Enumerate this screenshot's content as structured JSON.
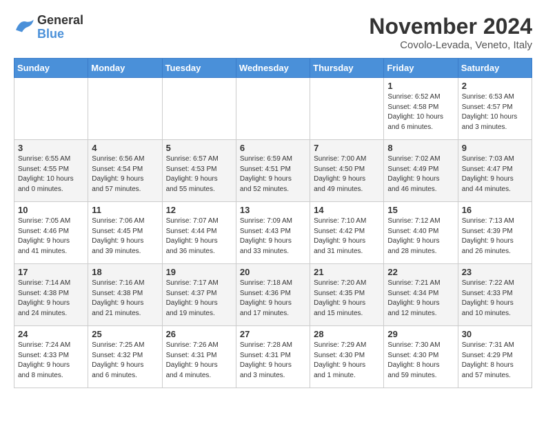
{
  "header": {
    "logo_line1": "General",
    "logo_line2": "Blue",
    "month": "November 2024",
    "location": "Covolo-Levada, Veneto, Italy"
  },
  "weekdays": [
    "Sunday",
    "Monday",
    "Tuesday",
    "Wednesday",
    "Thursday",
    "Friday",
    "Saturday"
  ],
  "weeks": [
    [
      {
        "day": "",
        "info": ""
      },
      {
        "day": "",
        "info": ""
      },
      {
        "day": "",
        "info": ""
      },
      {
        "day": "",
        "info": ""
      },
      {
        "day": "",
        "info": ""
      },
      {
        "day": "1",
        "info": "Sunrise: 6:52 AM\nSunset: 4:58 PM\nDaylight: 10 hours\nand 6 minutes."
      },
      {
        "day": "2",
        "info": "Sunrise: 6:53 AM\nSunset: 4:57 PM\nDaylight: 10 hours\nand 3 minutes."
      }
    ],
    [
      {
        "day": "3",
        "info": "Sunrise: 6:55 AM\nSunset: 4:55 PM\nDaylight: 10 hours\nand 0 minutes."
      },
      {
        "day": "4",
        "info": "Sunrise: 6:56 AM\nSunset: 4:54 PM\nDaylight: 9 hours\nand 57 minutes."
      },
      {
        "day": "5",
        "info": "Sunrise: 6:57 AM\nSunset: 4:53 PM\nDaylight: 9 hours\nand 55 minutes."
      },
      {
        "day": "6",
        "info": "Sunrise: 6:59 AM\nSunset: 4:51 PM\nDaylight: 9 hours\nand 52 minutes."
      },
      {
        "day": "7",
        "info": "Sunrise: 7:00 AM\nSunset: 4:50 PM\nDaylight: 9 hours\nand 49 minutes."
      },
      {
        "day": "8",
        "info": "Sunrise: 7:02 AM\nSunset: 4:49 PM\nDaylight: 9 hours\nand 46 minutes."
      },
      {
        "day": "9",
        "info": "Sunrise: 7:03 AM\nSunset: 4:47 PM\nDaylight: 9 hours\nand 44 minutes."
      }
    ],
    [
      {
        "day": "10",
        "info": "Sunrise: 7:05 AM\nSunset: 4:46 PM\nDaylight: 9 hours\nand 41 minutes."
      },
      {
        "day": "11",
        "info": "Sunrise: 7:06 AM\nSunset: 4:45 PM\nDaylight: 9 hours\nand 39 minutes."
      },
      {
        "day": "12",
        "info": "Sunrise: 7:07 AM\nSunset: 4:44 PM\nDaylight: 9 hours\nand 36 minutes."
      },
      {
        "day": "13",
        "info": "Sunrise: 7:09 AM\nSunset: 4:43 PM\nDaylight: 9 hours\nand 33 minutes."
      },
      {
        "day": "14",
        "info": "Sunrise: 7:10 AM\nSunset: 4:42 PM\nDaylight: 9 hours\nand 31 minutes."
      },
      {
        "day": "15",
        "info": "Sunrise: 7:12 AM\nSunset: 4:40 PM\nDaylight: 9 hours\nand 28 minutes."
      },
      {
        "day": "16",
        "info": "Sunrise: 7:13 AM\nSunset: 4:39 PM\nDaylight: 9 hours\nand 26 minutes."
      }
    ],
    [
      {
        "day": "17",
        "info": "Sunrise: 7:14 AM\nSunset: 4:38 PM\nDaylight: 9 hours\nand 24 minutes."
      },
      {
        "day": "18",
        "info": "Sunrise: 7:16 AM\nSunset: 4:38 PM\nDaylight: 9 hours\nand 21 minutes."
      },
      {
        "day": "19",
        "info": "Sunrise: 7:17 AM\nSunset: 4:37 PM\nDaylight: 9 hours\nand 19 minutes."
      },
      {
        "day": "20",
        "info": "Sunrise: 7:18 AM\nSunset: 4:36 PM\nDaylight: 9 hours\nand 17 minutes."
      },
      {
        "day": "21",
        "info": "Sunrise: 7:20 AM\nSunset: 4:35 PM\nDaylight: 9 hours\nand 15 minutes."
      },
      {
        "day": "22",
        "info": "Sunrise: 7:21 AM\nSunset: 4:34 PM\nDaylight: 9 hours\nand 12 minutes."
      },
      {
        "day": "23",
        "info": "Sunrise: 7:22 AM\nSunset: 4:33 PM\nDaylight: 9 hours\nand 10 minutes."
      }
    ],
    [
      {
        "day": "24",
        "info": "Sunrise: 7:24 AM\nSunset: 4:33 PM\nDaylight: 9 hours\nand 8 minutes."
      },
      {
        "day": "25",
        "info": "Sunrise: 7:25 AM\nSunset: 4:32 PM\nDaylight: 9 hours\nand 6 minutes."
      },
      {
        "day": "26",
        "info": "Sunrise: 7:26 AM\nSunset: 4:31 PM\nDaylight: 9 hours\nand 4 minutes."
      },
      {
        "day": "27",
        "info": "Sunrise: 7:28 AM\nSunset: 4:31 PM\nDaylight: 9 hours\nand 3 minutes."
      },
      {
        "day": "28",
        "info": "Sunrise: 7:29 AM\nSunset: 4:30 PM\nDaylight: 9 hours\nand 1 minute."
      },
      {
        "day": "29",
        "info": "Sunrise: 7:30 AM\nSunset: 4:30 PM\nDaylight: 8 hours\nand 59 minutes."
      },
      {
        "day": "30",
        "info": "Sunrise: 7:31 AM\nSunset: 4:29 PM\nDaylight: 8 hours\nand 57 minutes."
      }
    ]
  ]
}
